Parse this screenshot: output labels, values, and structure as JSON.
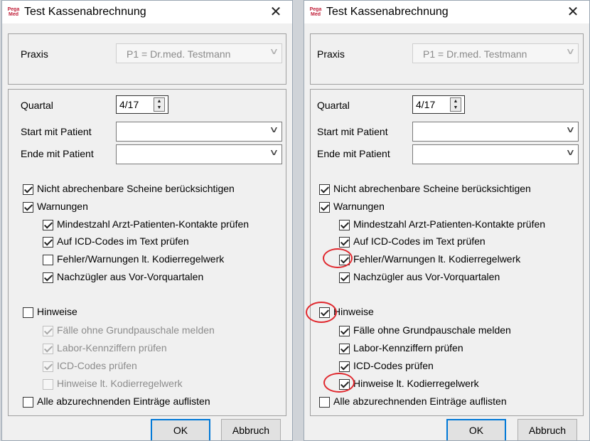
{
  "dialog": {
    "logo_top": "Pega",
    "logo_bottom": "Med",
    "title": "Test Kassenabrechnung",
    "close_glyph": "✕"
  },
  "praxis": {
    "label": "Praxis",
    "value": "P1 = Dr.med. Testmann"
  },
  "quartal": {
    "label": "Quartal",
    "value_left": "4/17",
    "value_right": "4/17"
  },
  "start_patient": {
    "label": "Start mit Patient",
    "value": ""
  },
  "ende_patient": {
    "label": "Ende mit Patient",
    "value": ""
  },
  "options": {
    "nicht_abrechenbare": "Nicht abrechenbare Scheine berücksichtigen",
    "warnungen": "Warnungen",
    "mindestzahl": "Mindestzahl Arzt-Patienten-Kontakte prüfen",
    "icd_text": "Auf ICD-Codes im Text prüfen",
    "fehler_warnungen": "Fehler/Warnungen lt. Kodierregelwerk",
    "nachzuegler": "Nachzügler aus Vor-Vorquartalen",
    "hinweise": "Hinweise",
    "faelle_ohne": "Fälle ohne Grundpauschale melden",
    "labor": "Labor-Kennziffern prüfen",
    "icd_pruefen": "ICD-Codes prüfen",
    "hinweise_kodier": "Hinweise lt. Kodierregelwerk",
    "alle_eintraege": "Alle abzurechnenden Einträge auflisten"
  },
  "state_left": {
    "nicht_abrechenbare": true,
    "warnungen": true,
    "mindestzahl": true,
    "icd_text": true,
    "fehler_warnungen": false,
    "nachzuegler": true,
    "hinweise": false,
    "faelle_ohne": true,
    "labor": true,
    "icd_pruefen": true,
    "hinweise_kodier": false,
    "alle_eintraege": false,
    "hinweise_children_disabled": true
  },
  "state_right": {
    "nicht_abrechenbare": true,
    "warnungen": true,
    "mindestzahl": true,
    "icd_text": true,
    "fehler_warnungen": true,
    "nachzuegler": true,
    "hinweise": true,
    "faelle_ohne": true,
    "labor": true,
    "icd_pruefen": true,
    "hinweise_kodier": true,
    "alle_eintraege": false,
    "hinweise_children_disabled": false
  },
  "buttons": {
    "ok": "OK",
    "cancel": "Abbruch"
  },
  "annotation_color": "#e0282e"
}
